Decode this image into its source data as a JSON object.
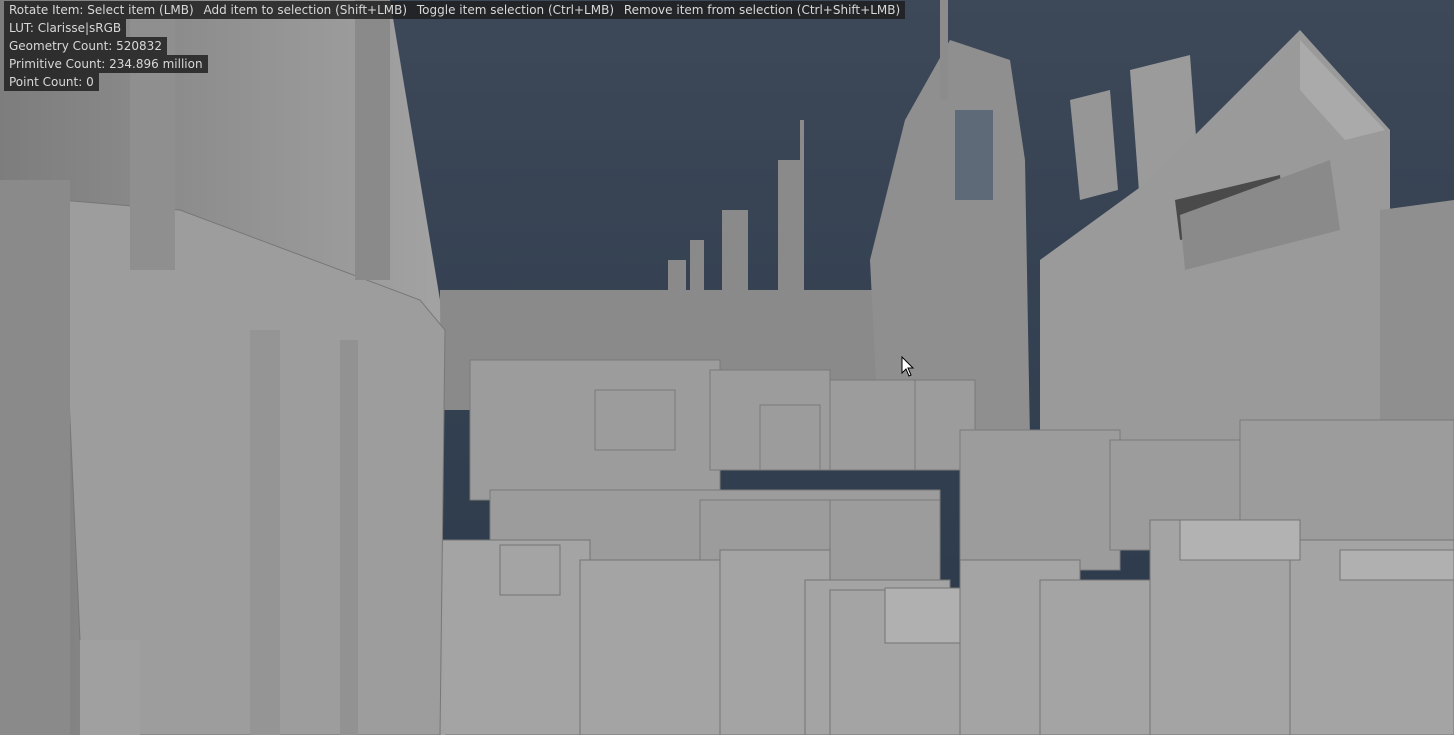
{
  "viewport": {
    "scene": "city-blockout-geometry",
    "colors": {
      "sky_top": "#3b4757",
      "sky_bottom": "#2b3a4b",
      "geometry": "#9a9a9a",
      "geometry_shadow": "#6e6e6e",
      "hud_bg": "#1c1c1c",
      "hud_text": "#d8d8d8"
    }
  },
  "hud": {
    "tips": [
      "Rotate Item: Select item (LMB)",
      "Add item to selection (Shift+LMB)",
      "Toggle item selection (Ctrl+LMB)",
      "Remove item from selection (Ctrl+Shift+LMB)"
    ],
    "lut": "LUT: Clarisse|sRGB",
    "geometry_count": "Geometry Count: 520832",
    "primitive_count": "Primitive Count: 234.896 million",
    "point_count": "Point Count: 0"
  },
  "cursor": {
    "icon": "mouse-pointer-icon"
  }
}
